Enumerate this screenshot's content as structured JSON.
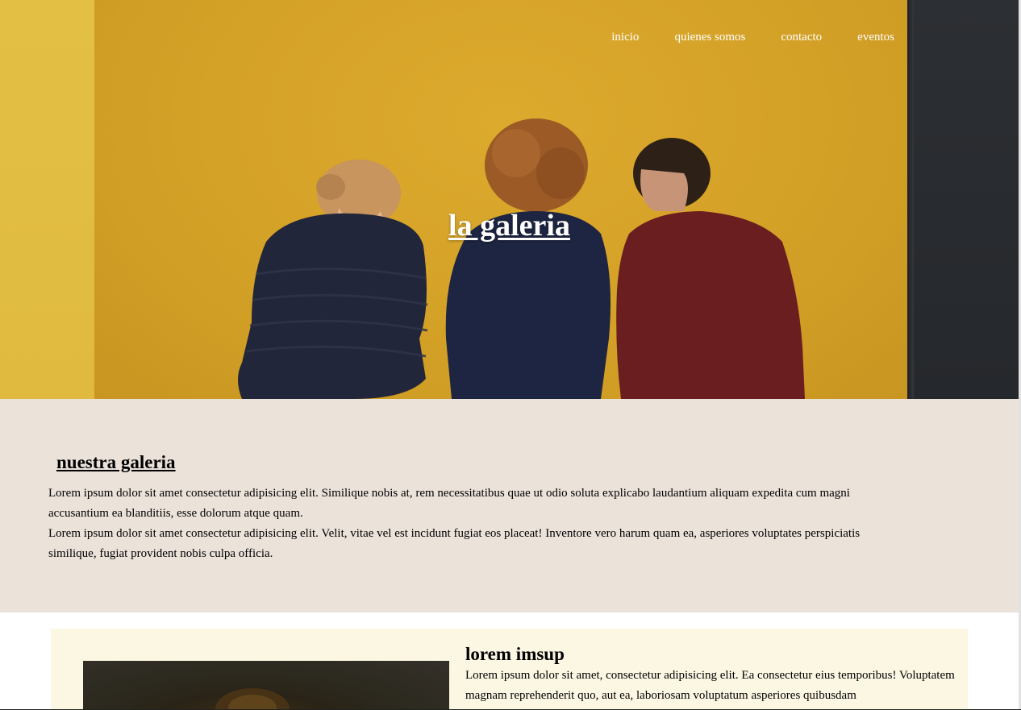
{
  "nav": {
    "items": [
      {
        "label": "inicio"
      },
      {
        "label": "quienes somos"
      },
      {
        "label": "contacto"
      },
      {
        "label": "eventos"
      }
    ]
  },
  "hero": {
    "title": "la galeria"
  },
  "about": {
    "heading": "nuestra galeria",
    "paragraphs": [
      "Lorem ipsum dolor sit amet consectetur adipisicing elit. Similique nobis at, rem necessitatibus quae ut odio soluta explicabo laudantium aliquam expedita cum magni accusantium ea blanditiis, esse dolorum atque quam.",
      "Lorem ipsum dolor sit amet consectetur adipisicing elit. Velit, vitae vel est incidunt fugiat eos placeat! Inventore vero harum quam ea, asperiores voluptates perspiciatis similique, fugiat provident nobis culpa officia."
    ]
  },
  "card": {
    "title": "lorem imsup",
    "body": "Lorem ipsum dolor sit amet, consectetur adipisicing elit. Ea consectetur eius temporibus! Voluptatem magnam reprehenderit quo, aut ea, laboriosam voluptatum asperiores quibusdam"
  },
  "colors": {
    "hero_wall": "#d4a127",
    "about_bg": "#ebe2da",
    "card_bg": "#fcf7e3"
  }
}
